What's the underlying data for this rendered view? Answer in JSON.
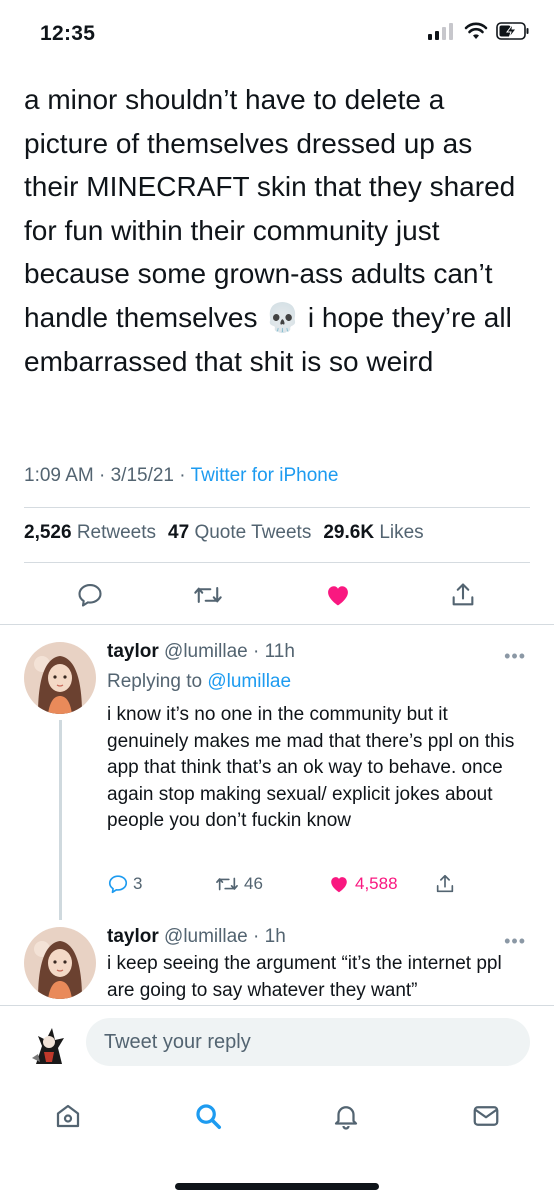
{
  "status_bar": {
    "time": "12:35"
  },
  "tweet": {
    "text": "a minor shouldn’t have to delete a picture of themselves dressed up as their MINECRAFT skin that they shared for fun within their community just because some grown-ass adults can’t handle themselves 💀 i hope they’re all embarrassed that shit is so weird",
    "time": "1:09 AM",
    "date": "3/15/21",
    "source": "Twitter for iPhone",
    "retweets_count": "2,526",
    "retweets_label": "Retweets",
    "quotes_count": "47",
    "quotes_label": "Quote Tweets",
    "likes_count": "29.6K",
    "likes_label": "Likes"
  },
  "replies": [
    {
      "name": "taylor",
      "handle": "@lumillae",
      "time": "11h",
      "replying_prefix": "Replying to",
      "replying_handle": "@lumillae",
      "text": "i know it’s no one in the community but it genuinely makes me mad that there’s ppl on this app that think that’s an ok way to behave. once again stop making sexual/ explicit jokes about people you don’t fuckin know",
      "reply_count": "3",
      "retweet_count": "46",
      "like_count": "4,588"
    },
    {
      "name": "taylor",
      "handle": "@lumillae",
      "time": "1h",
      "text": "i keep seeing the argument “it’s the internet ppl are going to say whatever they want”"
    }
  ],
  "reply_bar": {
    "placeholder": "Tweet your reply"
  },
  "colors": {
    "accent": "#1d9bf0",
    "like": "#f91880",
    "text": "#0f1419",
    "muted": "#536471"
  },
  "icons": [
    "reply-icon",
    "retweet-icon",
    "like-icon",
    "share-icon",
    "home-icon",
    "search-icon",
    "notifications-icon",
    "messages-icon"
  ]
}
